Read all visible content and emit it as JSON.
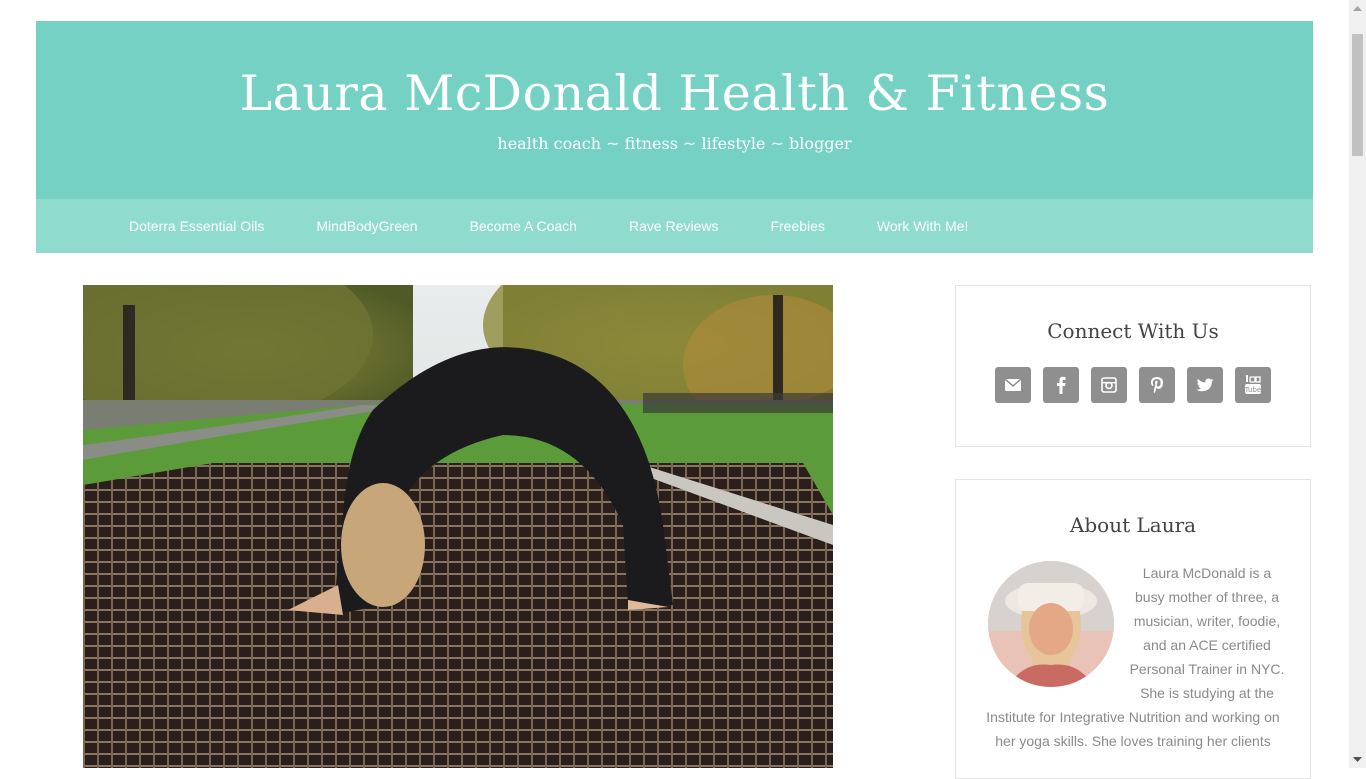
{
  "site": {
    "title": "Laura McDonald Health & Fitness",
    "tagline": "health coach ~ fitness ~ lifestyle ~ blogger"
  },
  "nav": {
    "items": [
      {
        "label": "Doterra Essential Oils"
      },
      {
        "label": "MindBodyGreen"
      },
      {
        "label": "Become A Coach"
      },
      {
        "label": "Rave Reviews"
      },
      {
        "label": "Freebies"
      },
      {
        "label": "Work With Me!"
      }
    ]
  },
  "sidebar": {
    "connect": {
      "title": "Connect With Us",
      "icons": [
        "email-icon",
        "facebook-icon",
        "instagram-icon",
        "pinterest-icon",
        "twitter-icon",
        "youtube-icon"
      ]
    },
    "about": {
      "title": "About Laura",
      "text": "Laura McDonald is a busy mother of three, a musician, writer, foodie, and an ACE certified Personal Trainer in NYC. She is studying at the Institute for Integrative Nutrition and working on her yoga skills. She loves training her clients"
    }
  },
  "colors": {
    "header_bg": "#74d1c4",
    "nav_bg": "#8fdccf",
    "social_bg": "#8f8f8f"
  }
}
